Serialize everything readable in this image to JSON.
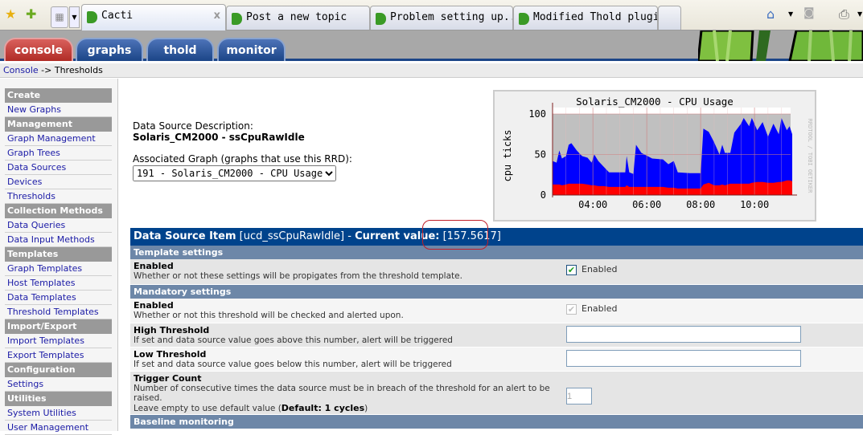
{
  "browser": {
    "tabs": [
      {
        "title": "Cacti",
        "active": true
      },
      {
        "title": "Post a new topic"
      },
      {
        "title": "Problem setting up..."
      },
      {
        "title": "Modified Thold plugin"
      }
    ],
    "toolbar_icons": [
      "bookmark-star-icon",
      "add-bookmark-icon",
      "tab-grid-icon",
      "home-icon",
      "rss-feed-icon",
      "print-icon"
    ]
  },
  "nav": {
    "tabs": [
      "console",
      "graphs",
      "thold",
      "monitor"
    ],
    "active": "console"
  },
  "breadcrumb": {
    "root": "Console",
    "separator": "->",
    "current": "Thresholds"
  },
  "sidebar": [
    {
      "header": "Create",
      "items": [
        "New Graphs"
      ]
    },
    {
      "header": "Management",
      "items": [
        "Graph Management",
        "Graph Trees",
        "Data Sources",
        "Devices",
        "Thresholds"
      ]
    },
    {
      "header": "Collection Methods",
      "items": [
        "Data Queries",
        "Data Input Methods"
      ]
    },
    {
      "header": "Templates",
      "items": [
        "Graph Templates",
        "Host Templates",
        "Data Templates",
        "Threshold Templates"
      ]
    },
    {
      "header": "Import/Export",
      "items": [
        "Import Templates",
        "Export Templates"
      ]
    },
    {
      "header": "Configuration",
      "items": [
        "Settings"
      ]
    },
    {
      "header": "Utilities",
      "items": [
        "System Utilities",
        "User Management"
      ]
    }
  ],
  "main": {
    "ds_desc_label": "Data Source Description:",
    "ds_desc_value": "Solaris_CM2000 - ssCpuRawIdle",
    "assoc_label": "Associated Graph (graphs that use this RRD):",
    "assoc_value": "191 - Solaris_CM2000 - CPU Usage"
  },
  "graph": {
    "title": "Solaris_CM2000 - CPU Usage",
    "ylabel": "cpu ticks",
    "watermark": "RRDTOOL / TOBI OETIKER",
    "yticks": [
      "0",
      "50",
      "100"
    ],
    "xticks": [
      "04:00",
      "06:00",
      "08:00",
      "10:00"
    ],
    "colors": {
      "blue": "#0000ff",
      "red": "#ff0000",
      "bg": "#c0c0c0"
    },
    "points": [
      [
        "02:30",
        42,
        13
      ],
      [
        "02:39",
        40,
        13
      ],
      [
        "02:45",
        55,
        13
      ],
      [
        "02:51",
        45,
        12
      ],
      [
        "03:00",
        48,
        13
      ],
      [
        "03:06",
        62,
        14
      ],
      [
        "03:12",
        64,
        14
      ],
      [
        "03:24",
        55,
        14
      ],
      [
        "03:36",
        48,
        14
      ],
      [
        "03:48",
        46,
        13
      ],
      [
        "03:57",
        40,
        12
      ],
      [
        "04:03",
        50,
        12
      ],
      [
        "04:12",
        42,
        11
      ],
      [
        "04:24",
        35,
        11
      ],
      [
        "04:36",
        28,
        10
      ],
      [
        "05:12",
        28,
        10
      ],
      [
        "05:15",
        48,
        12
      ],
      [
        "05:21",
        28,
        10
      ],
      [
        "05:30",
        26,
        10
      ],
      [
        "05:36",
        62,
        10
      ],
      [
        "05:48",
        52,
        10
      ],
      [
        "06:12",
        45,
        10
      ],
      [
        "06:36",
        44,
        10
      ],
      [
        "06:48",
        38,
        9
      ],
      [
        "07:00",
        42,
        9
      ],
      [
        "07:09",
        28,
        8
      ],
      [
        "07:36",
        27,
        8
      ],
      [
        "08:00",
        27,
        8
      ],
      [
        "08:06",
        82,
        13
      ],
      [
        "08:18",
        78,
        15
      ],
      [
        "08:30",
        65,
        12
      ],
      [
        "08:42",
        50,
        12
      ],
      [
        "08:48",
        62,
        13
      ],
      [
        "08:54",
        52,
        12
      ],
      [
        "09:06",
        52,
        14
      ],
      [
        "09:15",
        77,
        14
      ],
      [
        "09:30",
        88,
        14
      ],
      [
        "09:36",
        95,
        14
      ],
      [
        "09:48",
        85,
        14
      ],
      [
        "09:54",
        95,
        15
      ],
      [
        "10:06",
        80,
        16
      ],
      [
        "10:18",
        90,
        16
      ],
      [
        "10:30",
        72,
        15
      ],
      [
        "10:42",
        88,
        15
      ],
      [
        "10:54",
        75,
        16
      ],
      [
        "11:00",
        95,
        16
      ],
      [
        "11:12",
        80,
        18
      ],
      [
        "11:18",
        85,
        18
      ],
      [
        "11:24",
        75,
        17
      ]
    ]
  },
  "table": {
    "header_label": "Data Source Item",
    "header_item": "[ucd_ssCpuRawIdle]",
    "header_sep": " - ",
    "cv_label": "Current value:",
    "cv_value": "[157.5617]",
    "sections": {
      "template": "Template settings",
      "mandatory": "Mandatory settings",
      "baseline": "Baseline monitoring"
    },
    "rows": {
      "t_enabled": {
        "title": "Enabled",
        "desc": "Whether or not these settings will be propigates from the threshold template.",
        "label": "Enabled",
        "checked": true
      },
      "m_enabled": {
        "title": "Enabled",
        "desc": "Whether or not this threshold will be checked and alerted upon.",
        "label": "Enabled",
        "checked": true,
        "disabled": true
      },
      "high": {
        "title": "High Threshold",
        "desc": "If set and data source value goes above this number, alert will be triggered",
        "value": ""
      },
      "low": {
        "title": "Low Threshold",
        "desc": "If set and data source value goes below this number, alert will be triggered",
        "value": ""
      },
      "trigger": {
        "title": "Trigger Count",
        "desc": "Number of consecutive times the data source must be in breach of the threshold for an alert to be raised.",
        "desc2": "Leave empty to use default value (",
        "default_b": "Default: 1 cycles",
        "desc2_end": ")",
        "value": "1"
      }
    }
  }
}
